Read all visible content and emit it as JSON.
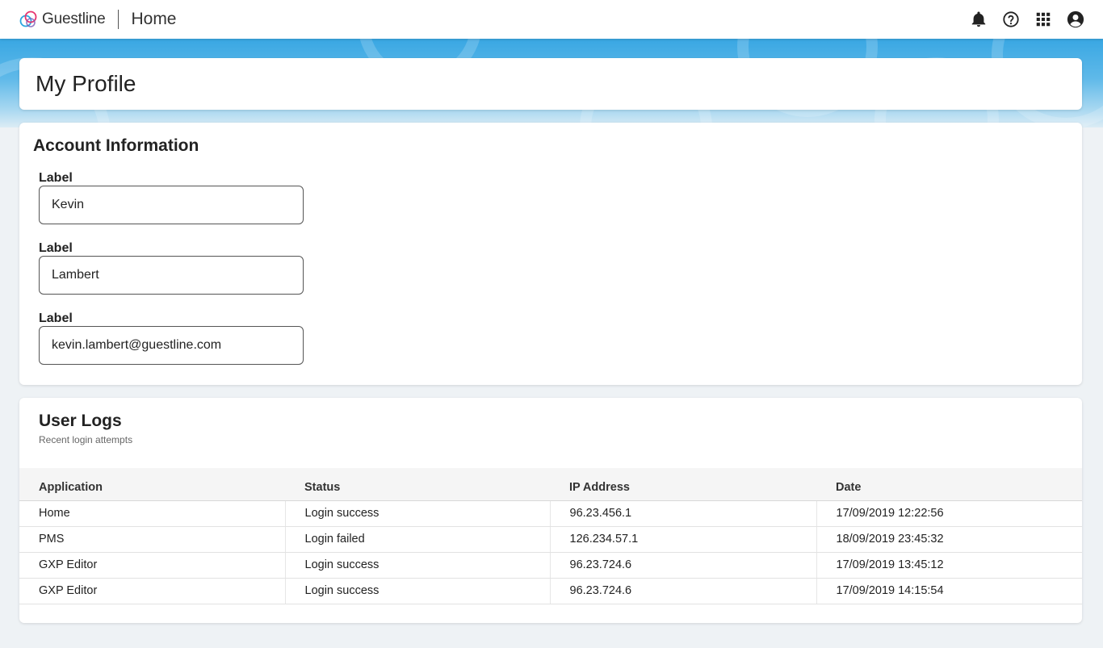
{
  "header": {
    "brand_name": "Guestline",
    "app_title": "Home",
    "icons": [
      "bell-icon",
      "help-icon",
      "apps-grid-icon",
      "account-icon"
    ]
  },
  "profile": {
    "title": "My Profile"
  },
  "account": {
    "title": "Account Information",
    "fields": [
      {
        "label": "Label",
        "value": "Kevin"
      },
      {
        "label": "Label",
        "value": "Lambert"
      },
      {
        "label": "Label",
        "value": "kevin.lambert@guestline.com"
      }
    ]
  },
  "logs": {
    "title": "User Logs",
    "subtitle": "Recent login attempts",
    "columns": [
      "Application",
      "Status",
      "IP Address",
      "Date"
    ],
    "rows": [
      [
        "Home",
        "Login success",
        "96.23.456.1",
        "17/09/2019 12:22:56"
      ],
      [
        "PMS",
        "Login failed",
        "126.234.57.1",
        "18/09/2019 23:45:32"
      ],
      [
        "GXP Editor",
        "Login success",
        "96.23.724.6",
        "17/09/2019 13:45:12"
      ],
      [
        "GXP Editor",
        "Login success",
        "96.23.724.6",
        "17/09/2019 14:15:54"
      ]
    ]
  },
  "colors": {
    "hero_top": "#39a7e3",
    "brand_pink": "#e8336d",
    "brand_blue": "#2aa6e0"
  }
}
